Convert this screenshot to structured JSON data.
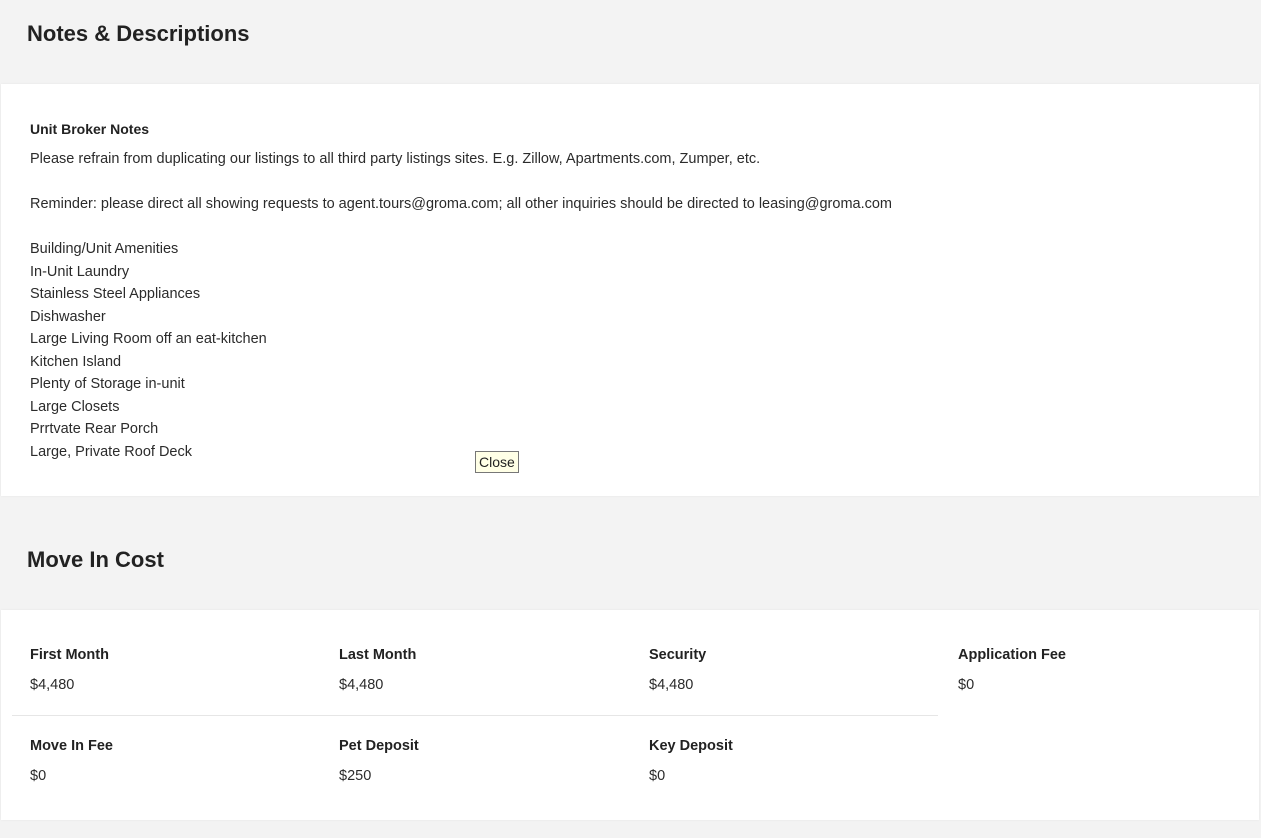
{
  "notes_section": {
    "title": "Notes & Descriptions",
    "broker_heading": "Unit Broker Notes",
    "lines": [
      "Please refrain from duplicating our listings to all third party listings sites. E.g. Zillow, Apartments.com, Zumper, etc.",
      "",
      "Reminder: please direct all showing requests to agent.tours@groma.com; all other inquiries should be directed to leasing@groma.com",
      "",
      "Building/Unit Amenities",
      "In-Unit Laundry",
      "Stainless Steel Appliances",
      "Dishwasher",
      "Large Living Room off an eat-kitchen",
      "Kitchen Island",
      "Plenty of Storage in-unit",
      "Large Closets",
      "Prrtvate Rear Porch",
      "Large, Private Roof Deck"
    ],
    "close_label": "Close"
  },
  "cost_section": {
    "title": "Move In Cost",
    "items": [
      {
        "label": "First Month",
        "value": "$4,480"
      },
      {
        "label": "Last Month",
        "value": "$4,480"
      },
      {
        "label": "Security",
        "value": "$4,480"
      },
      {
        "label": "Application Fee",
        "value": "$0"
      },
      {
        "label": "Move In Fee",
        "value": "$0"
      },
      {
        "label": "Pet Deposit",
        "value": "$250"
      },
      {
        "label": "Key Deposit",
        "value": "$0"
      }
    ]
  }
}
